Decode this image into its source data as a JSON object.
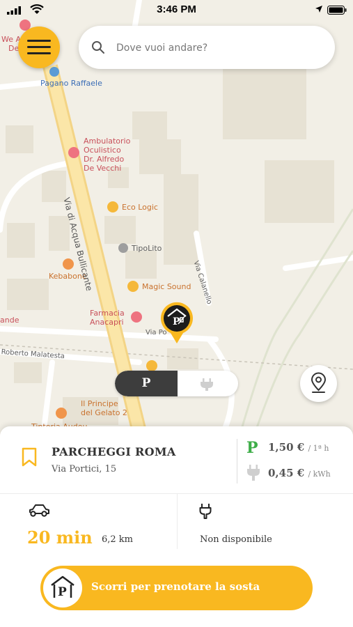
{
  "status_bar": {
    "time": "3:46 PM"
  },
  "search": {
    "placeholder": "Dove vuoi andare?"
  },
  "map": {
    "labels": {
      "we": "We A",
      "de": "De",
      "pagano": "Pagano Raffaele",
      "amb1": "Ambulatorio",
      "amb2": "Oculistico",
      "amb3": "Dr. Alfredo",
      "amb4": "De Vecchi",
      "ecologic": "Eco Logic",
      "tipolito": "TipoLito",
      "kebabone": "Kebabone",
      "magic": "Magic Sound",
      "farmacia1": "Farmacia",
      "farmacia2": "Anacapri",
      "street_main": "Via di Acqua Bullicante",
      "street_calanello": "Via Calanello",
      "street_portici": "Via Po",
      "street_malatesta": "Roberto Malatesta",
      "ande": "ande",
      "principe1": "Il Principe",
      "principe2": "del Gelato 2",
      "tintoria": "Tintoria Audou"
    }
  },
  "toggle": {
    "parking_label": "P",
    "selected": "parking"
  },
  "parking": {
    "name": "PARCHEGGI ROMA",
    "address": "Via Portici, 15",
    "price_parking": "1,50 €",
    "price_parking_unit": "/ 1ª h",
    "price_charge": "0,45 €",
    "price_charge_unit": "/ kWh",
    "eta": "20 min",
    "distance": "6,2 km",
    "charging_status": "Non disponibile"
  },
  "cta": {
    "label": "Scorri per prenotare la sosta",
    "knob_letter": "P"
  },
  "colors": {
    "accent": "#f9b820",
    "parking_green": "#3fae49",
    "dark": "#3d3d3d"
  }
}
